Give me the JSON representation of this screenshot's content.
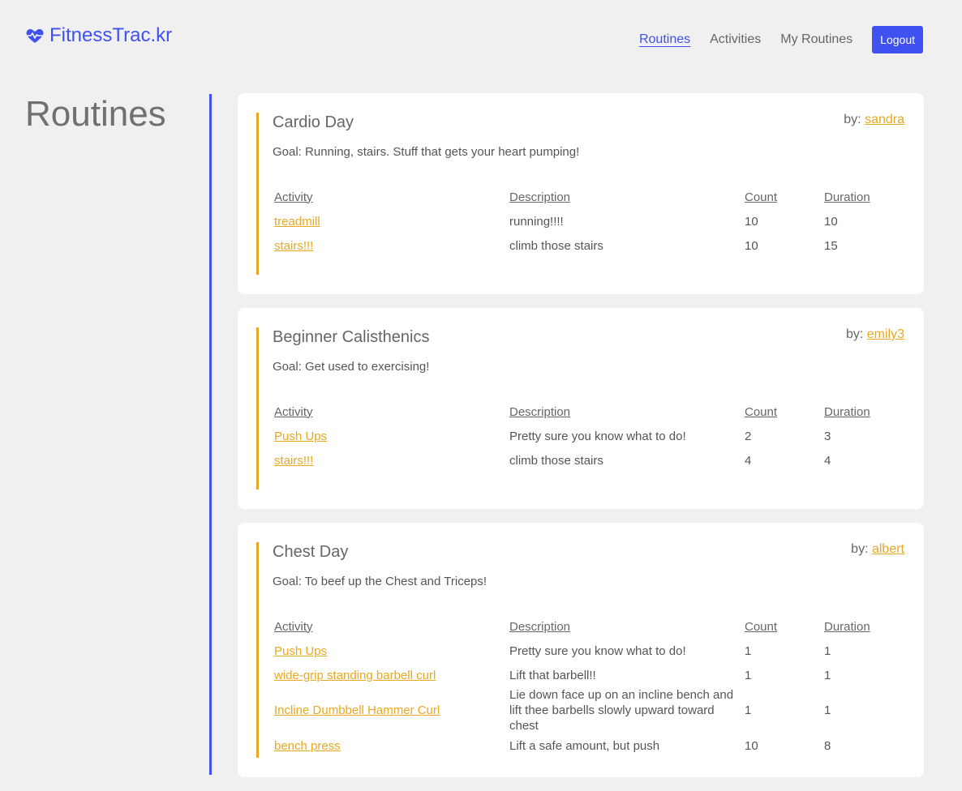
{
  "brand": {
    "name": "FitnessTrac.kr",
    "accent": "#3f51f0",
    "link_color": "#e8a820"
  },
  "nav": {
    "routines": "Routines",
    "activities": "Activities",
    "my_routines": "My Routines",
    "logout": "Logout"
  },
  "page": {
    "title": "Routines"
  },
  "table_headers": {
    "activity": "Activity",
    "description": "Description",
    "count": "Count",
    "duration": "Duration"
  },
  "by_label": "by:",
  "routines": [
    {
      "name": "Cardio Day",
      "creator": "sandra",
      "goal": "Goal: Running, stairs. Stuff that gets your heart pumping!",
      "activities": [
        {
          "name": "treadmill",
          "description": "running!!!!",
          "count": "10",
          "duration": "10"
        },
        {
          "name": "stairs!!!",
          "description": "climb those stairs",
          "count": "10",
          "duration": "15"
        }
      ]
    },
    {
      "name": "Beginner Calisthenics",
      "creator": "emily3",
      "goal": "Goal: Get used to exercising!",
      "activities": [
        {
          "name": "Push Ups",
          "description": "Pretty sure you know what to do!",
          "count": "2",
          "duration": "3"
        },
        {
          "name": "stairs!!!",
          "description": "climb those stairs",
          "count": "4",
          "duration": "4"
        }
      ]
    },
    {
      "name": "Chest Day",
      "creator": "albert",
      "goal": "Goal: To beef up the Chest and Triceps!",
      "activities": [
        {
          "name": "Push Ups",
          "description": "Pretty sure you know what to do!",
          "count": "1",
          "duration": "1"
        },
        {
          "name": "wide-grip standing barbell curl",
          "description": "Lift that barbell!!",
          "count": "1",
          "duration": "1"
        },
        {
          "name": "Incline Dumbbell Hammer Curl",
          "description": "Lie down face up on an incline bench and lift thee barbells slowly upward toward chest",
          "count": "1",
          "duration": "1"
        },
        {
          "name": "bench press",
          "description": "Lift a safe amount, but push",
          "count": "10",
          "duration": "8"
        }
      ]
    }
  ]
}
